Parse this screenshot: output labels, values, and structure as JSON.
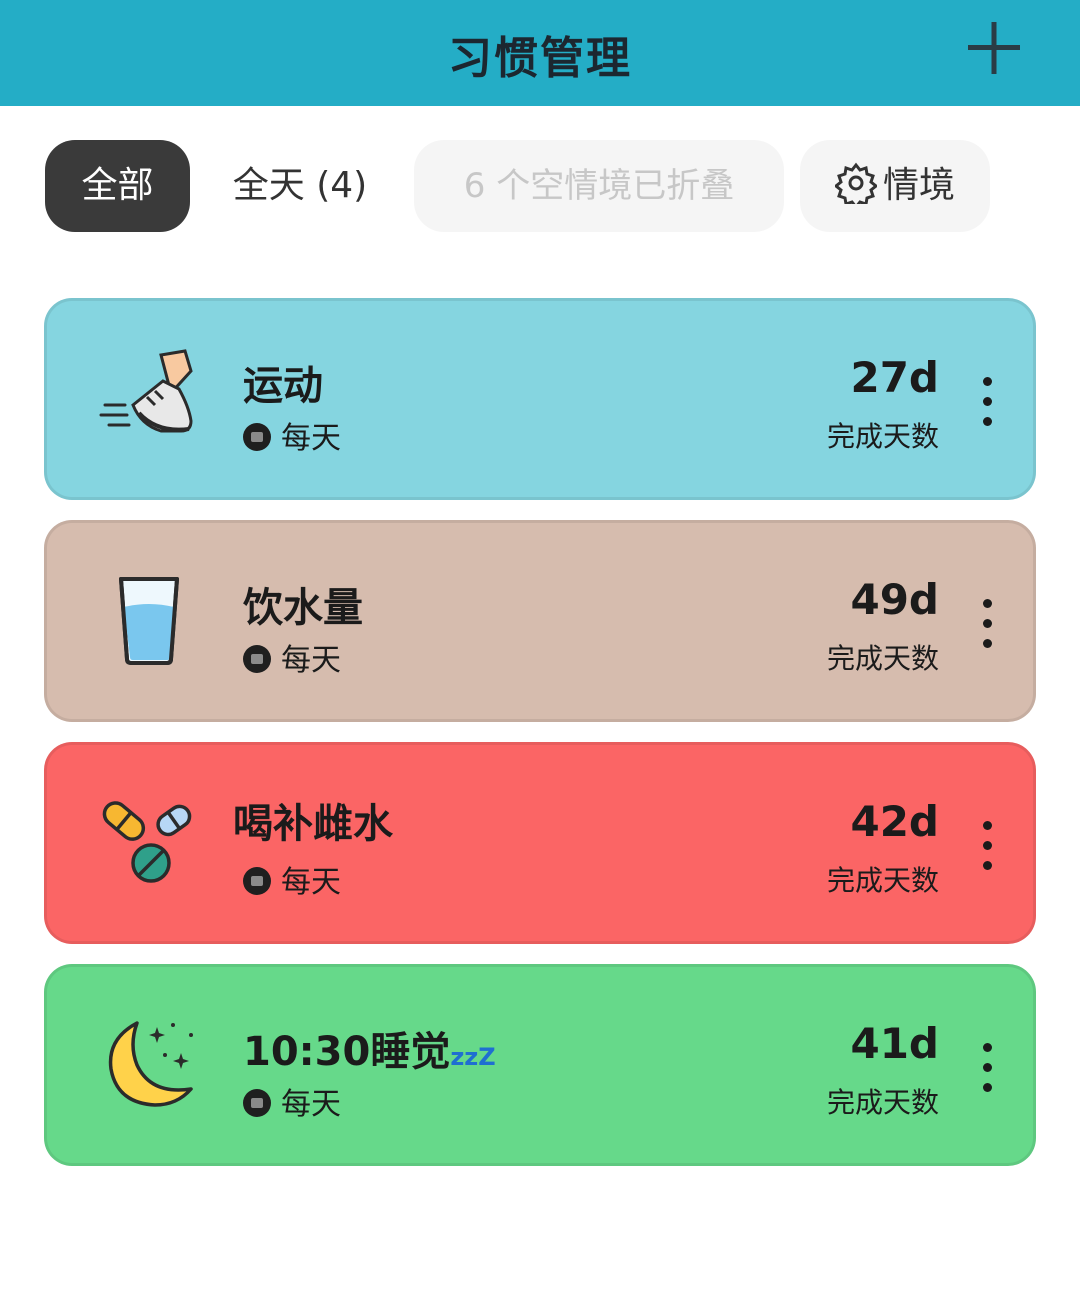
{
  "header": {
    "title": "习惯管理",
    "add_icon": "plus-icon"
  },
  "filters": {
    "all": "全部",
    "all_day": "全天 (4)",
    "folded": "6 个空情境已折叠",
    "context": "情境",
    "context_icon": "gear-icon"
  },
  "habits": [
    {
      "name": "运动",
      "frequency": "每天",
      "days": "27d",
      "days_label": "完成天数",
      "color": "#85d5e0",
      "icon": "running-shoe-icon"
    },
    {
      "name": "饮水量",
      "frequency": "每天",
      "days": "49d",
      "days_label": "完成天数",
      "color": "#d6bcae",
      "icon": "water-glass-icon"
    },
    {
      "name": "喝补雌水",
      "frequency": "每天",
      "days": "42d",
      "days_label": "完成天数",
      "color": "#fb6565",
      "icon": "pills-icon"
    },
    {
      "name": "10:30睡觉",
      "name_suffix": "zzZ",
      "frequency": "每天",
      "days": "41d",
      "days_label": "完成天数",
      "color": "#66d98a",
      "icon": "crescent-moon-icon"
    }
  ]
}
